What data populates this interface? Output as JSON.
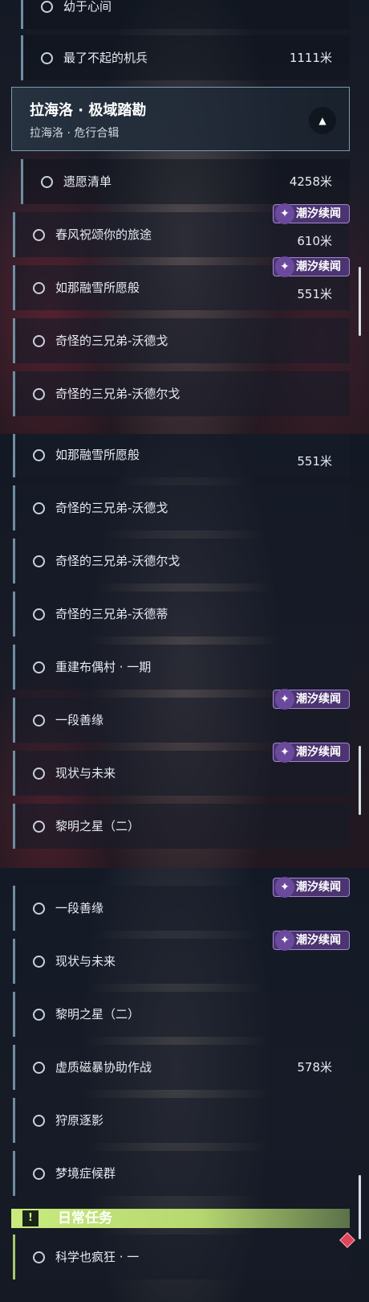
{
  "tag_label": "潮汐续闻",
  "panel1": {
    "top_partial": "幼于心间",
    "header": {
      "title": "拉海洛 · 极域踏勘",
      "subtitle": "拉海洛 · 危行合辑"
    },
    "rows": [
      {
        "label": "最了不起的机兵",
        "dist": "1111米"
      },
      {
        "label": "遗愿清单",
        "dist": "4258米"
      },
      {
        "label": "春风祝颂你的旅途",
        "dist": "610米"
      },
      {
        "label": "如那融雪所愿般",
        "dist": "551米"
      },
      {
        "label": "奇怪的三兄弟-沃德戈",
        "dist": ""
      },
      {
        "label": "奇怪的三兄弟-沃德尔戈",
        "dist": ""
      }
    ]
  },
  "panel2": {
    "rows": [
      {
        "label": "如那融雪所愿般",
        "dist": "551米"
      },
      {
        "label": "奇怪的三兄弟-沃德戈",
        "dist": ""
      },
      {
        "label": "奇怪的三兄弟-沃德尔戈",
        "dist": ""
      },
      {
        "label": "奇怪的三兄弟-沃德蒂",
        "dist": ""
      },
      {
        "label": "重建布偶村 · 一期",
        "dist": ""
      },
      {
        "label": "一段善缘",
        "dist": ""
      },
      {
        "label": "现状与未来",
        "dist": ""
      },
      {
        "label": "黎明之星（二）",
        "dist": ""
      }
    ]
  },
  "panel3": {
    "rows": [
      {
        "label": "一段善缘",
        "dist": ""
      },
      {
        "label": "现状与未来",
        "dist": ""
      },
      {
        "label": "黎明之星（二）",
        "dist": ""
      },
      {
        "label": "虚质磁暴协助作战",
        "dist": "578米"
      },
      {
        "label": "狩原逐影",
        "dist": ""
      },
      {
        "label": "梦境症候群",
        "dist": ""
      },
      {
        "label": "科学也疯狂 · 一",
        "dist": ""
      }
    ],
    "section": {
      "title": "日常任务",
      "icon": "!"
    }
  },
  "icons": {
    "tag": "sparkle-icon",
    "collapse": "chevron-up-icon",
    "section": "exclamation-icon",
    "marker": "diamond-marker-icon"
  },
  "colors": {
    "accent_row": "#6f8da0",
    "tag_bg": "#4b3470",
    "daily_bg": "#c9ea7d",
    "marker": "#e0445a"
  }
}
